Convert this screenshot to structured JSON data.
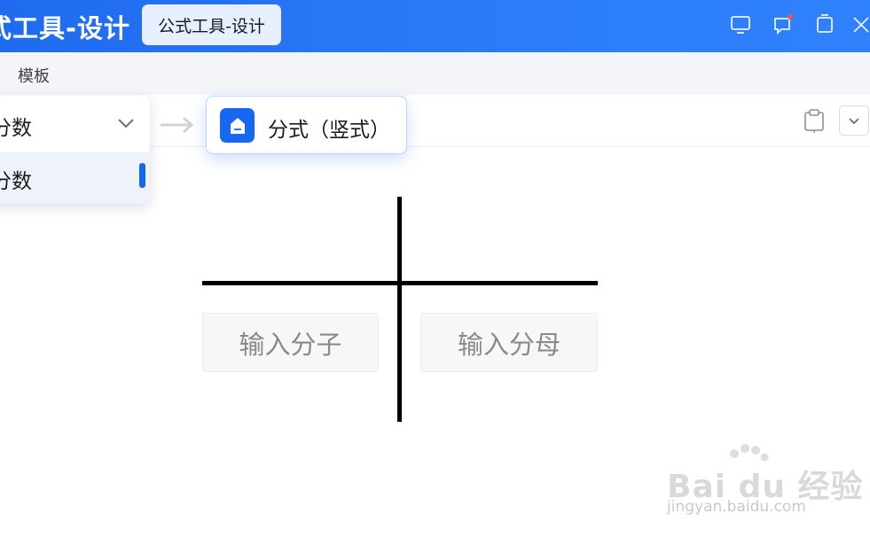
{
  "titlebar": {
    "app_title": "式工具-设计",
    "active_tab": "公式工具-设计",
    "buttons": [
      "monitor-icon",
      "notification-icon",
      "window-icon",
      "close-icon"
    ],
    "accent_color": "#2476f6"
  },
  "menubar": {
    "items": [
      {
        "label": "模板"
      }
    ]
  },
  "type_dropdown": {
    "selected": "分数",
    "options": [
      {
        "label": "分数",
        "highlighted": true
      }
    ]
  },
  "template_chip": {
    "label": "分式（竖式）",
    "icon": "fraction-template-icon"
  },
  "toolbar": {
    "right_icons": [
      "clipboard-icon",
      "chevron-down-icon"
    ]
  },
  "canvas": {
    "numerator_placeholder": "输入分子",
    "denominator_placeholder": "输入分母"
  },
  "watermark": {
    "logo": "Bai du 经验",
    "url": "jingyan.baidu.com"
  }
}
